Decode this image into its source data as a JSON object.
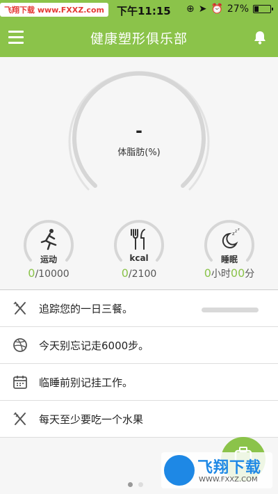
{
  "status_bar": {
    "carrier": "飞翔下载 www.FXXZ.com",
    "time": "下午11:15",
    "battery": "27%",
    "battery_level": 0.27
  },
  "app_bar": {
    "title": "健康塑形俱乐部"
  },
  "gauge": {
    "value": "-",
    "label": "体脂肪(%)"
  },
  "stats": [
    {
      "icon": "running-icon",
      "label": "运动",
      "current": "0",
      "target": "/10000"
    },
    {
      "icon": "utensils-icon",
      "label": "kcal",
      "current": "0",
      "target": "/2100"
    },
    {
      "icon": "sleep-moon-icon",
      "label": "睡眠",
      "hours": "0",
      "hours_unit": "小时",
      "minutes": "00",
      "minutes_unit": "分"
    }
  ],
  "tips": [
    {
      "icon": "utensils-icon",
      "text": "追踪您的一日三餐。"
    },
    {
      "icon": "dribbble-icon",
      "text": "今天别忘记走6000步。"
    },
    {
      "icon": "calendar-icon",
      "text": "临睡前别记挂工作。"
    },
    {
      "icon": "utensils-icon",
      "text": "每天至少要吃一个水果"
    }
  ],
  "watermark": {
    "main": "飞翔下载",
    "sub": "WWW.FXXZ.COM"
  },
  "colors": {
    "accent": "#8bc34a",
    "ring_gray": "#d6d6d6"
  }
}
